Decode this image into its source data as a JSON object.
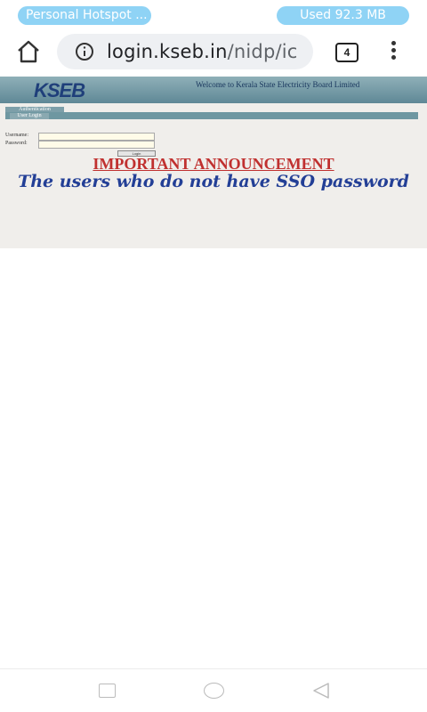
{
  "status_bar": {
    "hotspot_label": "Personal Hotspot ...",
    "data_used": "Used  92.3 MB"
  },
  "browser": {
    "url_domain": "login.kseb.in",
    "url_path": "/nidp/ic",
    "tab_count": "4"
  },
  "page": {
    "logo_text": "KSEB",
    "welcome_text": "Welcome to Kerala State Electricity Board Limited",
    "auth_tab": "Authentication",
    "login_tab": "User Login",
    "username_label": "Username:",
    "password_label": "Password:",
    "login_button": "Login",
    "announcement_title": "IMPORTANT ANNOUNCEMENT",
    "announcement_line": "The users who do not have SSO password"
  },
  "colors": {
    "pill": "#8fd3f5",
    "banner": "#5f8896",
    "announcement_red": "#c0302f",
    "announcement_blue": "#233f96"
  }
}
